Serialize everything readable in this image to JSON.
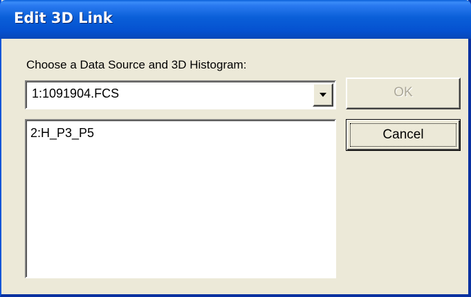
{
  "window": {
    "title": "Edit 3D Link"
  },
  "form": {
    "label": "Choose a Data Source and 3D Histogram:",
    "data_source": {
      "selected": "1:1091904.FCS"
    },
    "histograms": [
      "2:H_P3_P5"
    ]
  },
  "buttons": {
    "ok": {
      "label": "OK",
      "enabled": false
    },
    "cancel": {
      "label": "Cancel",
      "focused": true
    }
  },
  "colors": {
    "titlebar": "#0a5fd8",
    "dialog_bg": "#ece9d8",
    "disabled_text": "#aca899"
  }
}
